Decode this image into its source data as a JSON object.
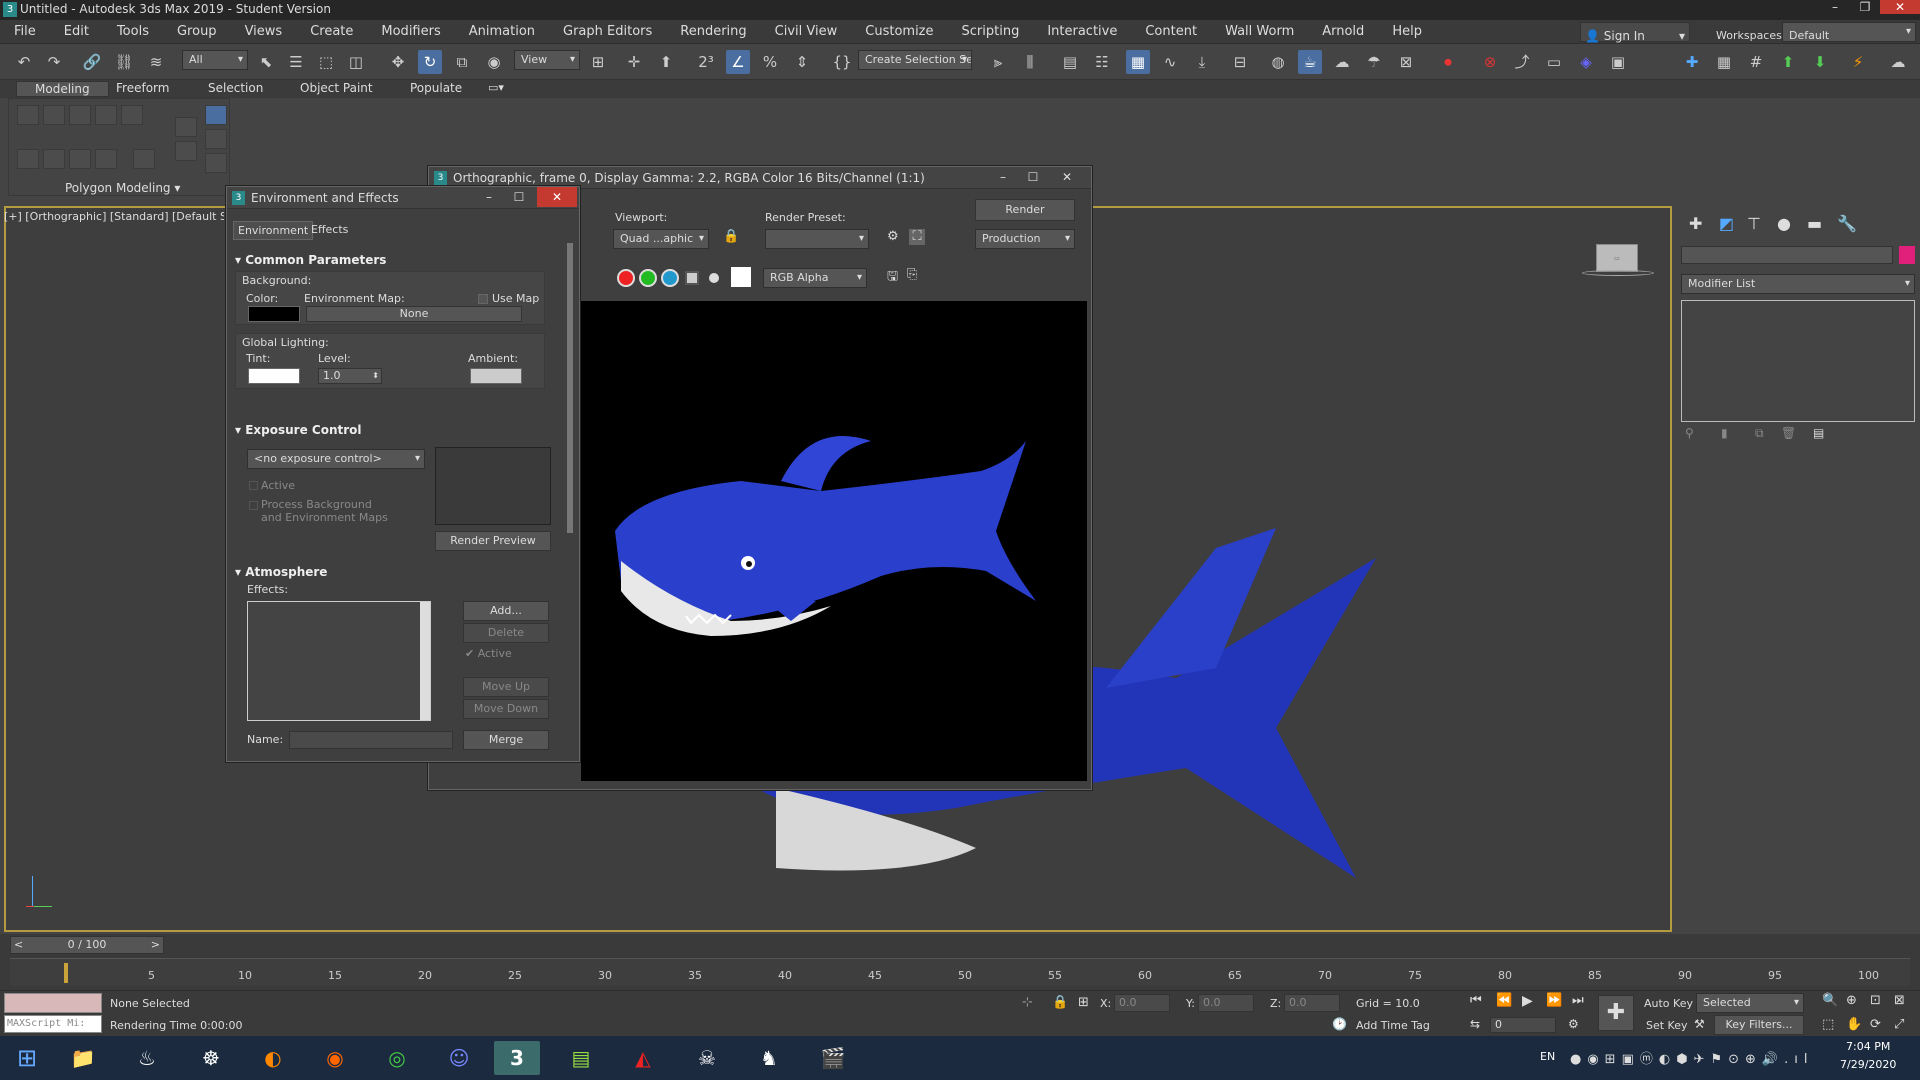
{
  "app": {
    "title": "Untitled - Autodesk 3ds Max 2019 - Student Version",
    "menus": [
      "File",
      "Edit",
      "Tools",
      "Group",
      "Views",
      "Create",
      "Modifiers",
      "Animation",
      "Graph Editors",
      "Rendering",
      "Civil View",
      "Customize",
      "Scripting",
      "Interactive",
      "Content",
      "Wall Worm",
      "Arnold",
      "Help"
    ],
    "sign_in": "Sign In",
    "workspaces_label": "Workspaces:",
    "workspace_value": "Default"
  },
  "toolbar": {
    "filter": "All",
    "ref_coord": "View",
    "selection_set": "Create Selection Se"
  },
  "ribbon": {
    "tabs": [
      "Modeling",
      "Freeform",
      "Selection",
      "Object Paint",
      "Populate"
    ],
    "panel_label": "Polygon Modeling"
  },
  "viewport": {
    "label": "[+] [Orthographic] [Standard] [Default Shading]"
  },
  "env_dialog": {
    "title": "Environment and Effects",
    "tabs": [
      "Environment",
      "Effects"
    ],
    "common": {
      "header": "Common Parameters",
      "background": "Background:",
      "color": "Color:",
      "env_map": "Environment Map:",
      "use_map": "Use Map",
      "map_button": "None",
      "global_lighting": "Global Lighting:",
      "tint": "Tint:",
      "level": "Level:",
      "level_value": "1.0",
      "ambient": "Ambient:"
    },
    "exposure": {
      "header": "Exposure Control",
      "dropdown": "<no exposure control>",
      "active": "Active",
      "process_bg_1": "Process Background",
      "process_bg_2": "and Environment Maps",
      "render_preview": "Render Preview"
    },
    "atmosphere": {
      "header": "Atmosphere",
      "effects": "Effects:",
      "add": "Add...",
      "delete": "Delete",
      "active": "Active",
      "move_up": "Move Up",
      "move_down": "Move Down",
      "name": "Name:",
      "merge": "Merge"
    }
  },
  "render_window": {
    "title": "Orthographic, frame 0, Display Gamma: 2.2, RGBA Color 16 Bits/Channel (1:1)",
    "viewport_label": "Viewport:",
    "viewport_value": "Quad ...aphic",
    "preset_label": "Render Preset:",
    "preset_value": "",
    "render_button": "Render",
    "production": "Production",
    "channel": "RGB Alpha"
  },
  "command_panel": {
    "modifier_list": "Modifier List"
  },
  "timeline": {
    "frame": "0 / 100",
    "ticks": [
      "5",
      "10",
      "15",
      "20",
      "25",
      "30",
      "35",
      "40",
      "45",
      "50",
      "55",
      "60",
      "65",
      "70",
      "75",
      "80",
      "85",
      "90",
      "95",
      "100"
    ]
  },
  "status": {
    "none_selected": "None Selected",
    "rendering_time": "Rendering Time  0:00:00",
    "maxscript": "MAXScript Mi:",
    "x_label": "X:",
    "x_value": "0.0",
    "y_label": "Y:",
    "y_value": "0.0",
    "z_label": "Z:",
    "z_value": "0.0",
    "grid": "Grid = 10.0",
    "add_time_tag": "Add Time Tag",
    "auto_key": "Auto Key",
    "selected": "Selected",
    "set_key": "Set Key",
    "key_filters": "Key Filters...",
    "frame_value": "0"
  },
  "taskbar": {
    "lang": "EN",
    "time": "7:04 PM",
    "date": "7/29/2020"
  },
  "colors": {
    "accent": "#4a6ea0",
    "shark_blue": "#2234b8",
    "viewport_border": "#b59b3f",
    "close_red": "#c43a31"
  }
}
